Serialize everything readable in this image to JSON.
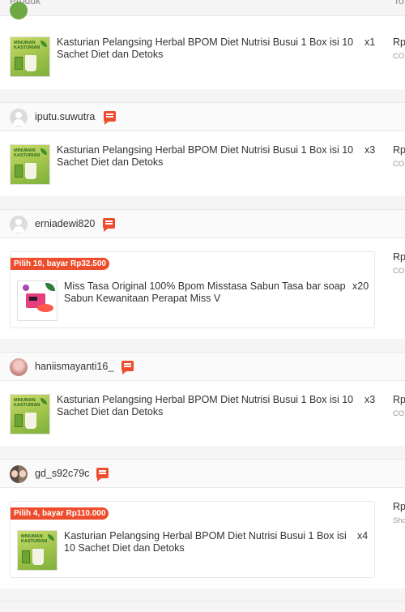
{
  "columns": {
    "product": "Produk",
    "total": "To"
  },
  "orders": [
    {
      "username": "",
      "avatar": "photo-green",
      "items": [
        {
          "title": "Kasturian Pelangsing Herbal BPOM Diet Nutrisi Busui 1 Box isi 10 Sachet Diet dan Detoks",
          "qty": "x1",
          "price": "Rp",
          "sub": "COD"
        }
      ]
    },
    {
      "username": "iputu.suwutra",
      "avatar": "default",
      "items": [
        {
          "title": "Kasturian Pelangsing Herbal BPOM Diet Nutrisi Busui 1 Box isi 10 Sachet Diet dan Detoks",
          "qty": "x3",
          "price": "Rp",
          "sub": "COD"
        }
      ]
    },
    {
      "username": "erniadewi820",
      "avatar": "default",
      "bundle": "Pilih 10, bayar Rp32.500",
      "items": [
        {
          "title": "Miss Tasa Original 100% Bpom Misstasa Sabun Tasa bar soap Sabun Kewanitaan Perapat Miss V",
          "qty": "x20",
          "price": "Rp",
          "sub": "COD"
        }
      ]
    },
    {
      "username": "haniismayanti16_",
      "avatar": "photo-pink",
      "items": [
        {
          "title": "Kasturian Pelangsing Herbal BPOM Diet Nutrisi Busui 1 Box isi 10 Sachet Diet dan Detoks",
          "qty": "x3",
          "price": "Rp",
          "sub": "COD"
        }
      ]
    },
    {
      "username": "gd_s92c79c",
      "avatar": "photo-duo",
      "bundle": "Pilih 4, bayar Rp110.000",
      "items": [
        {
          "title": "Kasturian Pelangsing Herbal BPOM Diet Nutrisi Busui 1 Box isi 10 Sachet Diet dan Detoks",
          "qty": "x4",
          "price": "Rp",
          "sub": "Sho"
        }
      ]
    }
  ],
  "thumb_label": "MINUMAN KASTURIAN",
  "colors": {
    "accent": "#ee4d2d",
    "border": "#e8e8e8",
    "bg": "#f5f5f5"
  }
}
